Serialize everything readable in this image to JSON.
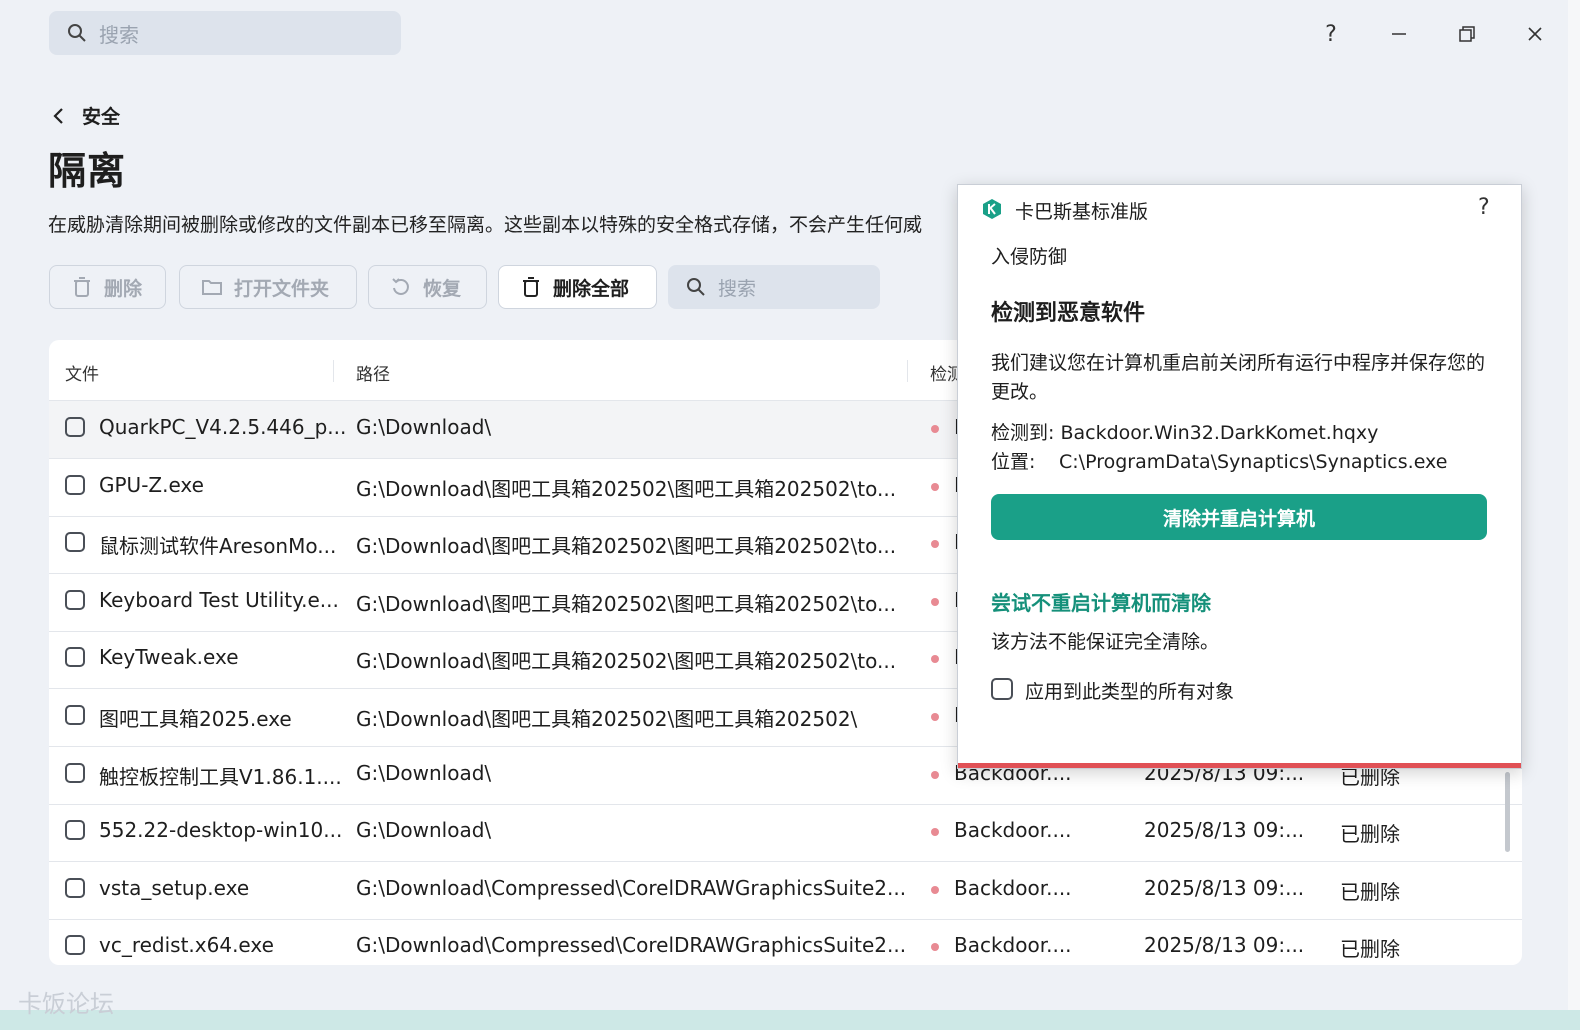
{
  "app": {
    "search_placeholder": "搜索",
    "window_controls": {
      "help": "?",
      "minimize": "—",
      "restore": "❐",
      "close": "✕"
    }
  },
  "breadcrumb": {
    "back_label": "安全"
  },
  "page": {
    "title": "隔离",
    "description": "在威胁清除期间被删除或修改的文件副本已移至隔离。这些副本以特殊的安全格式存储，不会产生任何威"
  },
  "toolbar": {
    "delete": "删除",
    "open_folder": "打开文件夹",
    "restore": "恢复",
    "delete_all": "删除全部",
    "search_placeholder": "搜索"
  },
  "table": {
    "headers": {
      "file": "文件",
      "path": "路径",
      "detected": "检测"
    },
    "rows": [
      {
        "file": "QuarkPC_V4.2.5.446_p...",
        "path": "G:\\Download\\",
        "detected": "B",
        "date": "",
        "status": ""
      },
      {
        "file": "GPU-Z.exe",
        "path": "G:\\Download\\图吧工具箱202502\\图吧工具箱202502\\to...",
        "detected": "B",
        "date": "",
        "status": ""
      },
      {
        "file": "鼠标测试软件AresonMo...",
        "path": "G:\\Download\\图吧工具箱202502\\图吧工具箱202502\\to...",
        "detected": "B",
        "date": "",
        "status": ""
      },
      {
        "file": "Keyboard Test Utility.e...",
        "path": "G:\\Download\\图吧工具箱202502\\图吧工具箱202502\\to...",
        "detected": "B",
        "date": "",
        "status": ""
      },
      {
        "file": "KeyTweak.exe",
        "path": "G:\\Download\\图吧工具箱202502\\图吧工具箱202502\\to...",
        "detected": "B",
        "date": "",
        "status": ""
      },
      {
        "file": "图吧工具箱2025.exe",
        "path": "G:\\Download\\图吧工具箱202502\\图吧工具箱202502\\",
        "detected": "B",
        "date": "",
        "status": ""
      },
      {
        "file": "触控板控制工具V1.86.1....",
        "path": "G:\\Download\\",
        "detected": "Backdoor....",
        "date": "2025/8/13 09:...",
        "status": "已删除"
      },
      {
        "file": "552.22-desktop-win10...",
        "path": "G:\\Download\\",
        "detected": "Backdoor....",
        "date": "2025/8/13 09:...",
        "status": "已删除"
      },
      {
        "file": "vsta_setup.exe",
        "path": "G:\\Download\\Compressed\\CorelDRAWGraphicsSuite2...",
        "detected": "Backdoor....",
        "date": "2025/8/13 09:...",
        "status": "已删除"
      },
      {
        "file": "vc_redist.x64.exe",
        "path": "G:\\Download\\Compressed\\CorelDRAWGraphicsSuite2...",
        "detected": "Backdoor....",
        "date": "2025/8/13 09:...",
        "status": "已删除"
      }
    ]
  },
  "watermark": "卡饭论坛",
  "popup": {
    "app_name": "卡巴斯基标准版",
    "help": "?",
    "section": "入侵防御",
    "heading": "检测到恶意软件",
    "advice": "我们建议您在计算机重启前关闭所有运行中程序并保存您的更改。",
    "detected_label": "检测到:",
    "detected_value": "Backdoor.Win32.DarkKomet.hqxy",
    "location_label": "位置:",
    "location_value": "C:\\ProgramData\\Synaptics\\Synaptics.exe",
    "primary_button": "清除并重启计算机",
    "link": "尝试不重启计算机而清除",
    "note": "该方法不能保证完全清除。",
    "checkbox_label": "应用到此类型的所有对象",
    "colors": {
      "accent": "#1aa088",
      "link": "#15907a",
      "alert_bar": "#e05055"
    }
  }
}
